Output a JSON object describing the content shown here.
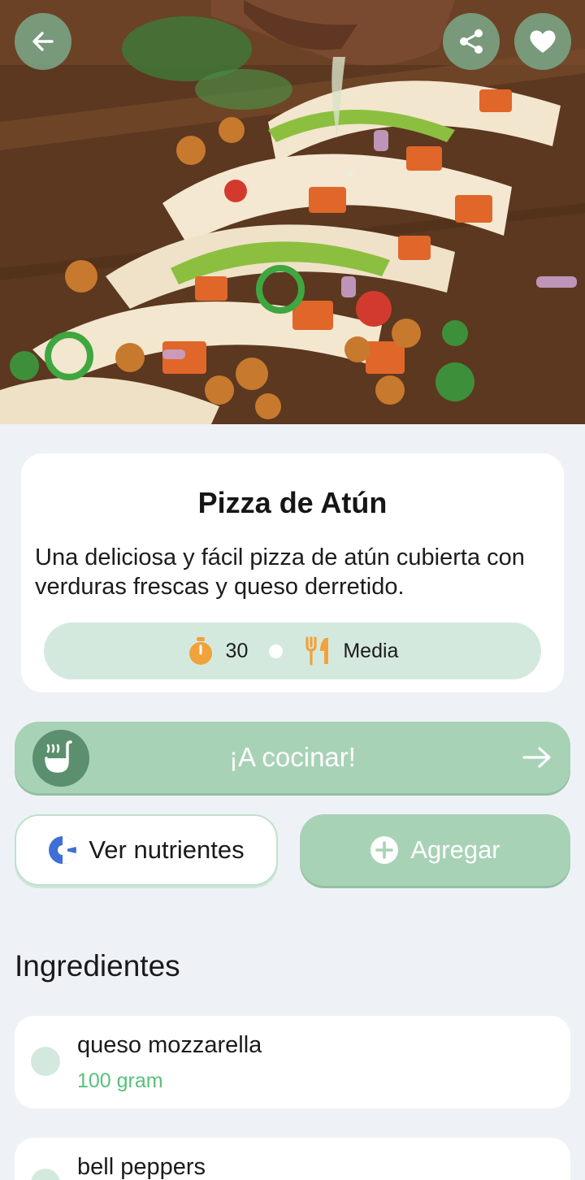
{
  "hero": {
    "image_desc_icon": "taco-photo",
    "back_icon": "arrow-left-icon",
    "share_icon": "share-icon",
    "favorite_icon": "heart-icon"
  },
  "recipe": {
    "title": "Pizza de Atún",
    "description": "Una deliciosa y fácil pizza de atún cubierta con verduras frescas y queso derretido.",
    "time": "30",
    "difficulty": "Media"
  },
  "actions": {
    "cook_label": "¡A cocinar!",
    "nutrients_label": "Ver nutrientes",
    "add_label": "Agregar"
  },
  "ingredients": {
    "heading": "Ingredientes",
    "items": [
      {
        "name": "queso mozzarella",
        "quantity": "100 gram"
      },
      {
        "name": "bell peppers",
        "quantity": ""
      }
    ]
  },
  "colors": {
    "accent": "#a8d2b6",
    "accent_dark": "#5b8f6d",
    "pill": "#d4e9de",
    "quantity_text": "#58c07b",
    "timer": "#f2a23a"
  }
}
